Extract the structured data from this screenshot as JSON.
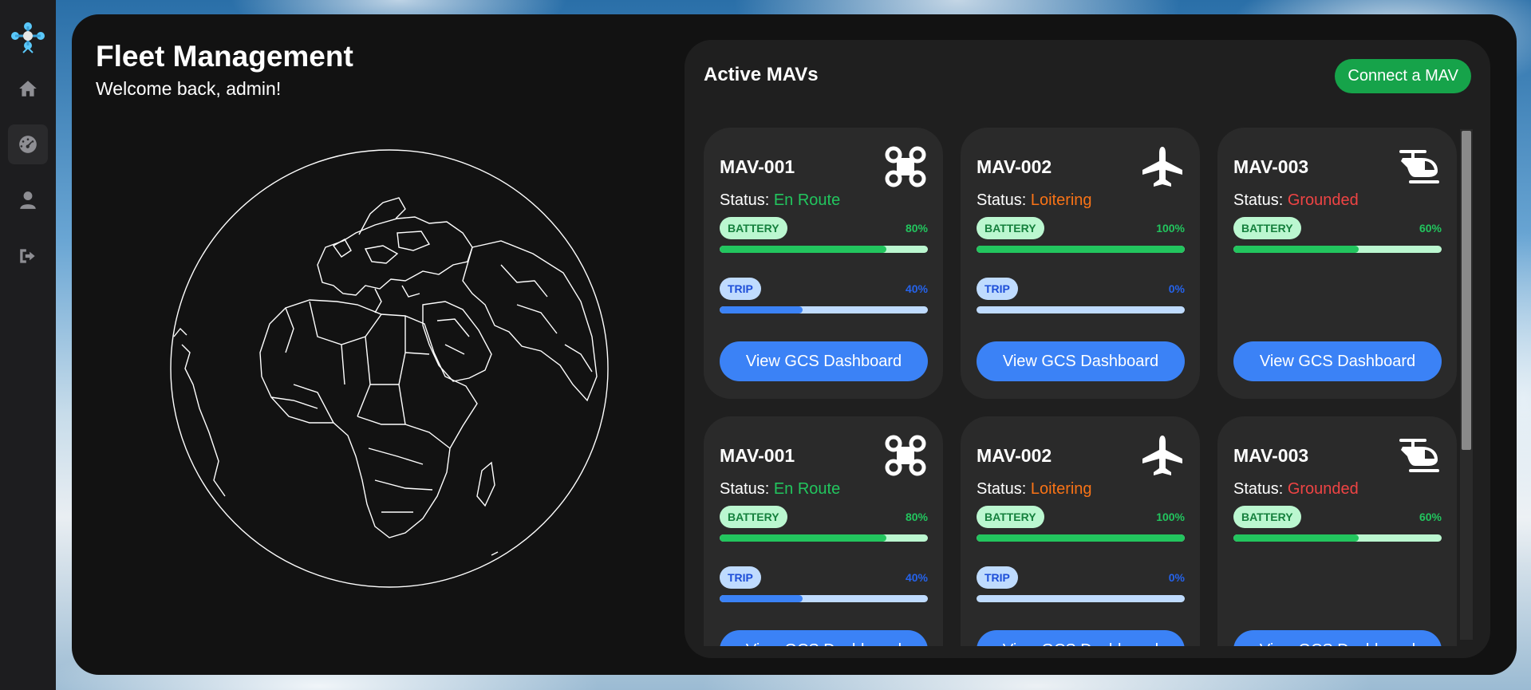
{
  "colors": {
    "accent_green": "#16a34a",
    "accent_blue": "#3b82f6",
    "status_en_route": "#22c55e",
    "status_loitering": "#f97316",
    "status_grounded": "#ef4444"
  },
  "sidebar": {
    "logo_icon": "drone-logo-icon",
    "items": [
      {
        "icon": "home-icon"
      },
      {
        "icon": "gauge-icon",
        "active": true
      },
      {
        "icon": "user-icon"
      },
      {
        "icon": "logout-icon"
      }
    ]
  },
  "header": {
    "title": "Fleet Management",
    "welcome": "Welcome back, admin!"
  },
  "mav_panel": {
    "title": "Active MAVs",
    "connect_label": "Connect a MAV",
    "status_prefix": "Status:",
    "battery_label": "BATTERY",
    "trip_label": "TRIP",
    "dashboard_label": "View GCS Dashboard",
    "cards": [
      {
        "name": "MAV-001",
        "icon": "quadcopter-icon",
        "status": "En Route",
        "status_color": "#22c55e",
        "battery": "80%",
        "battery_level": 80,
        "trip": "40%",
        "trip_level": 40
      },
      {
        "name": "MAV-002",
        "icon": "airplane-icon",
        "status": "Loitering",
        "status_color": "#f97316",
        "battery": "100%",
        "battery_level": 100,
        "trip": "0%",
        "trip_level": 0
      },
      {
        "name": "MAV-003",
        "icon": "helicopter-icon",
        "status": "Grounded",
        "status_color": "#ef4444",
        "battery": "60%",
        "battery_level": 60
      },
      {
        "name": "MAV-001",
        "icon": "quadcopter-icon",
        "status": "En Route",
        "status_color": "#22c55e",
        "battery": "80%",
        "battery_level": 80,
        "trip": "40%",
        "trip_level": 40
      },
      {
        "name": "MAV-002",
        "icon": "airplane-icon",
        "status": "Loitering",
        "status_color": "#f97316",
        "battery": "100%",
        "battery_level": 100,
        "trip": "0%",
        "trip_level": 0
      },
      {
        "name": "MAV-003",
        "icon": "helicopter-icon",
        "status": "Grounded",
        "status_color": "#ef4444",
        "battery": "60%",
        "battery_level": 60
      }
    ]
  }
}
